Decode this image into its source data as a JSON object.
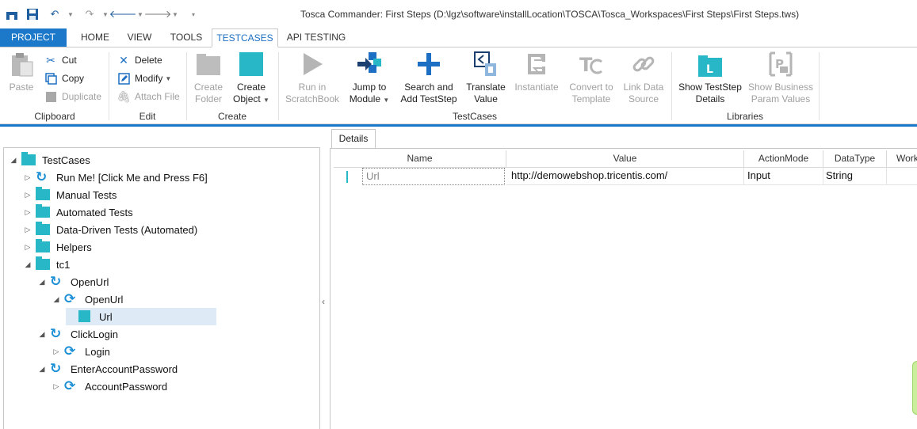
{
  "window": {
    "title": "Tosca Commander: First Steps (D:\\lgz\\software\\installLocation\\TOSCA\\Tosca_Workspaces\\First Steps\\First Steps.tws)"
  },
  "tabs": [
    "PROJECT",
    "HOME",
    "VIEW",
    "TOOLS",
    "TESTCASES",
    "API TESTING"
  ],
  "active_tab": "TESTCASES",
  "ribbon": {
    "clipboard": {
      "label": "Clipboard",
      "paste": "Paste",
      "cut": "Cut",
      "copy": "Copy",
      "duplicate": "Duplicate"
    },
    "edit": {
      "label": "Edit",
      "delete": "Delete",
      "modify": "Modify",
      "attach": "Attach File"
    },
    "create": {
      "label": "Create",
      "create_folder_1": "Create",
      "create_folder_2": "Folder",
      "create_object_1": "Create",
      "create_object_2": "Object"
    },
    "testcases": {
      "label": "TestCases",
      "run_1": "Run in",
      "run_2": "ScratchBook",
      "jump_1": "Jump to",
      "jump_2": "Module",
      "search_1": "Search and",
      "search_2": "Add TestStep",
      "translate_1": "Translate",
      "translate_2": "Value",
      "instantiate": "Instantiate",
      "convert_1": "Convert to",
      "convert_2": "Template",
      "link_1": "Link Data",
      "link_2": "Source"
    },
    "libraries": {
      "label": "Libraries",
      "show_details_1": "Show TestStep",
      "show_details_2": "Details",
      "show_business_1": "Show Business",
      "show_business_2": "Param Values"
    }
  },
  "tree": {
    "root": "TestCases",
    "items": [
      "Run Me! [Click Me and Press F6]",
      "Manual Tests",
      "Automated Tests",
      "Data-Driven Tests (Automated)",
      "Helpers",
      "tc1",
      "OpenUrl",
      "OpenUrl",
      "Url",
      "ClickLogin",
      "Login",
      "EnterAccountPassword",
      "AccountPassword"
    ]
  },
  "details": {
    "tab": "Details",
    "columns": [
      "Name",
      "Value",
      "ActionMode",
      "DataType",
      "Work"
    ],
    "row": {
      "name": "Url",
      "value": "http://demowebshop.tricentis.com/",
      "action_mode": "Input",
      "data_type": "String"
    }
  },
  "colors": {
    "accent": "#1c78c8",
    "teal": "#27b7c6",
    "icon_blue": "#1c8fd6"
  }
}
